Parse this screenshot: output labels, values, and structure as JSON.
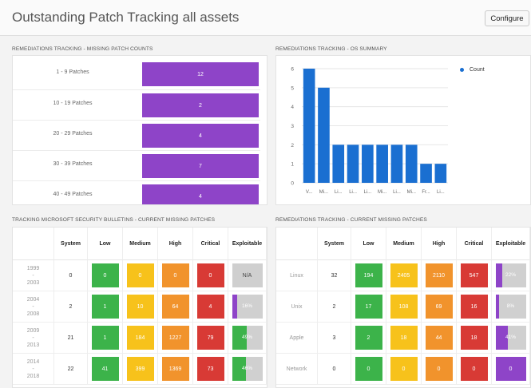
{
  "header": {
    "title": "Outstanding Patch Tracking all assets",
    "configure_label": "Configure"
  },
  "missing_counts": {
    "title": "REMEDIATIONS TRACKING - MISSING PATCH COUNTS",
    "rows": [
      {
        "label": "1 - 9 Patches",
        "value": "12"
      },
      {
        "label": "10 - 19 Patches",
        "value": "2"
      },
      {
        "label": "20 - 29 Patches",
        "value": "4"
      },
      {
        "label": "30 - 39 Patches",
        "value": "7"
      },
      {
        "label": "40 - 49 Patches",
        "value": "4"
      }
    ]
  },
  "os_summary": {
    "title": "REMEDIATIONS TRACKING - OS SUMMARY",
    "legend_label": "Count"
  },
  "chart_data": {
    "type": "bar",
    "title": "",
    "xlabel": "",
    "ylabel": "",
    "categories": [
      "V...",
      "Mi...",
      "Li...",
      "Li...",
      "Li...",
      "Mi...",
      "Li...",
      "Mi...",
      "Fr...",
      "Li..."
    ],
    "series": [
      {
        "name": "Count",
        "values": [
          6,
          5,
          2,
          2,
          2,
          2,
          2,
          2,
          1,
          1
        ]
      }
    ],
    "ylim": [
      0,
      6
    ],
    "yticks": [
      "0",
      "1",
      "2",
      "3",
      "4",
      "5",
      "6"
    ],
    "grid": true,
    "legend": "right",
    "color": "#1a6fd1"
  },
  "bulletins": {
    "title": "TRACKING MICROSOFT SECURITY BULLETINS - CURRENT MISSING PATCHES",
    "headers": [
      "",
      "System",
      "Low",
      "Medium",
      "High",
      "Critical",
      "Exploitable"
    ],
    "rows": [
      {
        "l1": "1999",
        "l2": "-",
        "l3": "2003",
        "system": "0",
        "low": "0",
        "medium": "0",
        "high": "0",
        "critical": "0",
        "exploitable": "N/A",
        "exploitable_pct": 0
      },
      {
        "l1": "2004",
        "l2": "-",
        "l3": "2008",
        "system": "2",
        "low": "1",
        "medium": "10",
        "high": "64",
        "critical": "4",
        "exploitable": "16%",
        "exploitable_pct": 16
      },
      {
        "l1": "2009",
        "l2": "-",
        "l3": "2013",
        "system": "21",
        "low": "1",
        "medium": "184",
        "high": "1227",
        "critical": "79",
        "exploitable": "49%",
        "exploitable_pct": 49
      },
      {
        "l1": "2014",
        "l2": "-",
        "l3": "2018",
        "system": "22",
        "low": "41",
        "medium": "399",
        "high": "1369",
        "critical": "73",
        "exploitable": "46%",
        "exploitable_pct": 46
      }
    ]
  },
  "current_missing": {
    "title": "REMEDIATIONS TRACKING - CURRENT MISSING PATCHES",
    "headers": [
      "",
      "System",
      "Low",
      "Medium",
      "High",
      "Critical",
      "Exploitable"
    ],
    "rows": [
      {
        "label": "Linux",
        "system": "32",
        "low": "194",
        "medium": "2405",
        "high": "2110",
        "critical": "547",
        "exploitable": "22%",
        "exploitable_pct": 22
      },
      {
        "label": "Unix",
        "system": "2",
        "low": "17",
        "medium": "108",
        "high": "69",
        "critical": "16",
        "exploitable": "8%",
        "exploitable_pct": 8
      },
      {
        "label": "Apple",
        "system": "3",
        "low": "2",
        "medium": "18",
        "high": "44",
        "critical": "18",
        "exploitable": "41%",
        "exploitable_pct": 41
      },
      {
        "label": "Network",
        "system": "0",
        "low": "0",
        "medium": "0",
        "high": "0",
        "critical": "0",
        "exploitable": "0",
        "exploitable_pct": 100
      }
    ]
  },
  "colors": {
    "low": "#3cb34a",
    "medium": "#f7c21b",
    "high": "#f1932c",
    "critical": "#d83a35",
    "accent": "#8e44c8",
    "bar": "#1a6fd1"
  }
}
